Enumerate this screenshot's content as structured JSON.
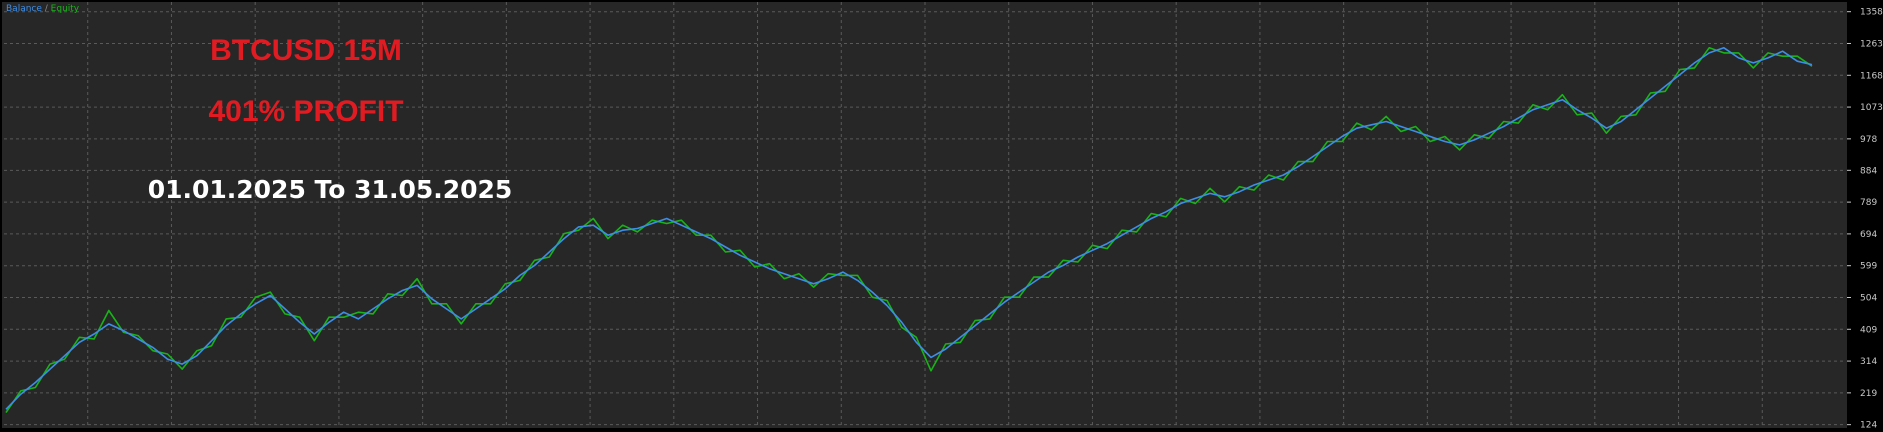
{
  "colors": {
    "background": "#272727",
    "frame": "#000000",
    "grid": "#5a5a5a",
    "balance": "#3d8ee8",
    "equity": "#19b319",
    "title": "#e11b22",
    "date": "#ffffff",
    "ticks": "#c8c8c8"
  },
  "legend": {
    "balance": "Balance",
    "separator": " / ",
    "equity": "Equity"
  },
  "overlay": {
    "title": "BTCUSD 15M",
    "profit": "401% PROFIT",
    "period": "01.01.2025 To 31.05.2025"
  },
  "chart_data": {
    "type": "line",
    "title": "",
    "xlabel": "",
    "ylabel": "",
    "ylim": [
      120,
      1375
    ],
    "yticks": [
      124,
      219,
      314,
      409,
      504,
      599,
      694,
      789,
      884,
      978,
      1073,
      1168,
      1263,
      1358
    ],
    "grid": true,
    "legend": "top-left",
    "series": [
      {
        "name": "Balance",
        "values": [
          170,
          215,
          250,
          290,
          330,
          370,
          395,
          425,
          405,
          380,
          355,
          320,
          305,
          330,
          375,
          420,
          455,
          485,
          510,
          470,
          430,
          395,
          430,
          460,
          440,
          470,
          500,
          525,
          540,
          500,
          470,
          440,
          470,
          500,
          530,
          570,
          600,
          640,
          680,
          715,
          720,
          690,
          705,
          710,
          725,
          740,
          720,
          700,
          680,
          655,
          630,
          610,
          590,
          575,
          560,
          545,
          560,
          580,
          555,
          520,
          480,
          430,
          370,
          325,
          350,
          385,
          420,
          455,
          490,
          520,
          550,
          580,
          600,
          625,
          645,
          665,
          690,
          715,
          740,
          760,
          785,
          800,
          815,
          805,
          820,
          840,
          855,
          870,
          895,
          925,
          955,
          985,
          1010,
          1020,
          1030,
          1015,
          1000,
          985,
          970,
          960,
          975,
          995,
          1015,
          1040,
          1065,
          1080,
          1095,
          1065,
          1040,
          1010,
          1030,
          1065,
          1100,
          1135,
          1170,
          1205,
          1235,
          1250,
          1220,
          1205,
          1220,
          1240,
          1210,
          1200
        ],
        "color": "#3d8ee8"
      },
      {
        "name": "Equity",
        "values": [
          160,
          225,
          235,
          305,
          320,
          385,
          380,
          465,
          400,
          390,
          345,
          335,
          290,
          345,
          360,
          440,
          445,
          505,
          520,
          455,
          445,
          375,
          445,
          445,
          460,
          455,
          515,
          510,
          560,
          485,
          485,
          425,
          485,
          485,
          545,
          555,
          615,
          625,
          695,
          705,
          740,
          680,
          720,
          700,
          735,
          725,
          735,
          690,
          690,
          640,
          645,
          595,
          605,
          560,
          575,
          535,
          575,
          570,
          570,
          505,
          495,
          415,
          385,
          285,
          365,
          370,
          435,
          440,
          505,
          505,
          565,
          565,
          615,
          610,
          660,
          650,
          705,
          700,
          755,
          745,
          800,
          785,
          830,
          790,
          835,
          825,
          870,
          855,
          910,
          910,
          970,
          970,
          1025,
          1005,
          1045,
          1000,
          1015,
          970,
          985,
          945,
          990,
          980,
          1030,
          1025,
          1080,
          1065,
          1110,
          1050,
          1055,
          995,
          1045,
          1050,
          1115,
          1120,
          1185,
          1190,
          1250,
          1235,
          1235,
          1190,
          1235,
          1225,
          1225,
          1195
        ],
        "color": "#19b319"
      }
    ]
  }
}
